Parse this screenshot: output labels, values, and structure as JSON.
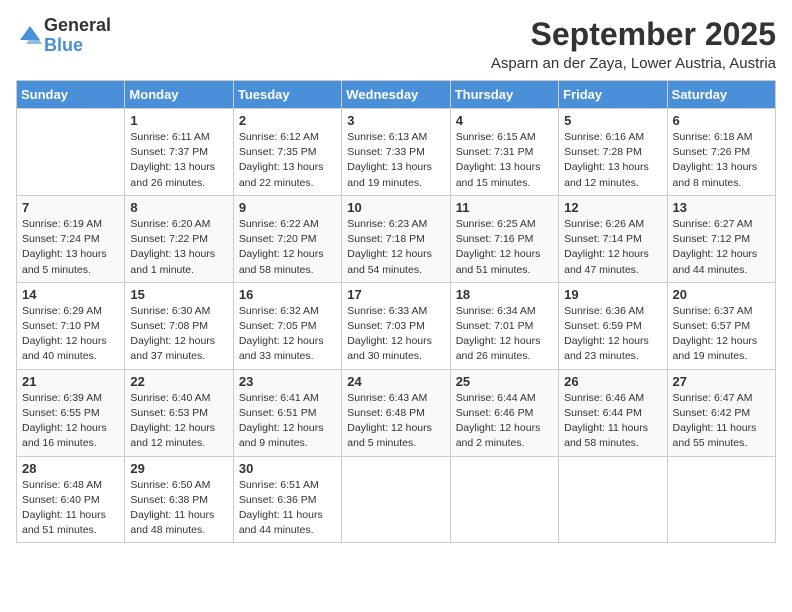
{
  "logo": {
    "general": "General",
    "blue": "Blue"
  },
  "header": {
    "month": "September 2025",
    "location": "Asparn an der Zaya, Lower Austria, Austria"
  },
  "weekdays": [
    "Sunday",
    "Monday",
    "Tuesday",
    "Wednesday",
    "Thursday",
    "Friday",
    "Saturday"
  ],
  "weeks": [
    [
      {
        "day": "",
        "info": ""
      },
      {
        "day": "1",
        "info": "Sunrise: 6:11 AM\nSunset: 7:37 PM\nDaylight: 13 hours\nand 26 minutes."
      },
      {
        "day": "2",
        "info": "Sunrise: 6:12 AM\nSunset: 7:35 PM\nDaylight: 13 hours\nand 22 minutes."
      },
      {
        "day": "3",
        "info": "Sunrise: 6:13 AM\nSunset: 7:33 PM\nDaylight: 13 hours\nand 19 minutes."
      },
      {
        "day": "4",
        "info": "Sunrise: 6:15 AM\nSunset: 7:31 PM\nDaylight: 13 hours\nand 15 minutes."
      },
      {
        "day": "5",
        "info": "Sunrise: 6:16 AM\nSunset: 7:28 PM\nDaylight: 13 hours\nand 12 minutes."
      },
      {
        "day": "6",
        "info": "Sunrise: 6:18 AM\nSunset: 7:26 PM\nDaylight: 13 hours\nand 8 minutes."
      }
    ],
    [
      {
        "day": "7",
        "info": "Sunrise: 6:19 AM\nSunset: 7:24 PM\nDaylight: 13 hours\nand 5 minutes."
      },
      {
        "day": "8",
        "info": "Sunrise: 6:20 AM\nSunset: 7:22 PM\nDaylight: 13 hours\nand 1 minute."
      },
      {
        "day": "9",
        "info": "Sunrise: 6:22 AM\nSunset: 7:20 PM\nDaylight: 12 hours\nand 58 minutes."
      },
      {
        "day": "10",
        "info": "Sunrise: 6:23 AM\nSunset: 7:18 PM\nDaylight: 12 hours\nand 54 minutes."
      },
      {
        "day": "11",
        "info": "Sunrise: 6:25 AM\nSunset: 7:16 PM\nDaylight: 12 hours\nand 51 minutes."
      },
      {
        "day": "12",
        "info": "Sunrise: 6:26 AM\nSunset: 7:14 PM\nDaylight: 12 hours\nand 47 minutes."
      },
      {
        "day": "13",
        "info": "Sunrise: 6:27 AM\nSunset: 7:12 PM\nDaylight: 12 hours\nand 44 minutes."
      }
    ],
    [
      {
        "day": "14",
        "info": "Sunrise: 6:29 AM\nSunset: 7:10 PM\nDaylight: 12 hours\nand 40 minutes."
      },
      {
        "day": "15",
        "info": "Sunrise: 6:30 AM\nSunset: 7:08 PM\nDaylight: 12 hours\nand 37 minutes."
      },
      {
        "day": "16",
        "info": "Sunrise: 6:32 AM\nSunset: 7:05 PM\nDaylight: 12 hours\nand 33 minutes."
      },
      {
        "day": "17",
        "info": "Sunrise: 6:33 AM\nSunset: 7:03 PM\nDaylight: 12 hours\nand 30 minutes."
      },
      {
        "day": "18",
        "info": "Sunrise: 6:34 AM\nSunset: 7:01 PM\nDaylight: 12 hours\nand 26 minutes."
      },
      {
        "day": "19",
        "info": "Sunrise: 6:36 AM\nSunset: 6:59 PM\nDaylight: 12 hours\nand 23 minutes."
      },
      {
        "day": "20",
        "info": "Sunrise: 6:37 AM\nSunset: 6:57 PM\nDaylight: 12 hours\nand 19 minutes."
      }
    ],
    [
      {
        "day": "21",
        "info": "Sunrise: 6:39 AM\nSunset: 6:55 PM\nDaylight: 12 hours\nand 16 minutes."
      },
      {
        "day": "22",
        "info": "Sunrise: 6:40 AM\nSunset: 6:53 PM\nDaylight: 12 hours\nand 12 minutes."
      },
      {
        "day": "23",
        "info": "Sunrise: 6:41 AM\nSunset: 6:51 PM\nDaylight: 12 hours\nand 9 minutes."
      },
      {
        "day": "24",
        "info": "Sunrise: 6:43 AM\nSunset: 6:48 PM\nDaylight: 12 hours\nand 5 minutes."
      },
      {
        "day": "25",
        "info": "Sunrise: 6:44 AM\nSunset: 6:46 PM\nDaylight: 12 hours\nand 2 minutes."
      },
      {
        "day": "26",
        "info": "Sunrise: 6:46 AM\nSunset: 6:44 PM\nDaylight: 11 hours\nand 58 minutes."
      },
      {
        "day": "27",
        "info": "Sunrise: 6:47 AM\nSunset: 6:42 PM\nDaylight: 11 hours\nand 55 minutes."
      }
    ],
    [
      {
        "day": "28",
        "info": "Sunrise: 6:48 AM\nSunset: 6:40 PM\nDaylight: 11 hours\nand 51 minutes."
      },
      {
        "day": "29",
        "info": "Sunrise: 6:50 AM\nSunset: 6:38 PM\nDaylight: 11 hours\nand 48 minutes."
      },
      {
        "day": "30",
        "info": "Sunrise: 6:51 AM\nSunset: 6:36 PM\nDaylight: 11 hours\nand 44 minutes."
      },
      {
        "day": "",
        "info": ""
      },
      {
        "day": "",
        "info": ""
      },
      {
        "day": "",
        "info": ""
      },
      {
        "day": "",
        "info": ""
      }
    ]
  ]
}
